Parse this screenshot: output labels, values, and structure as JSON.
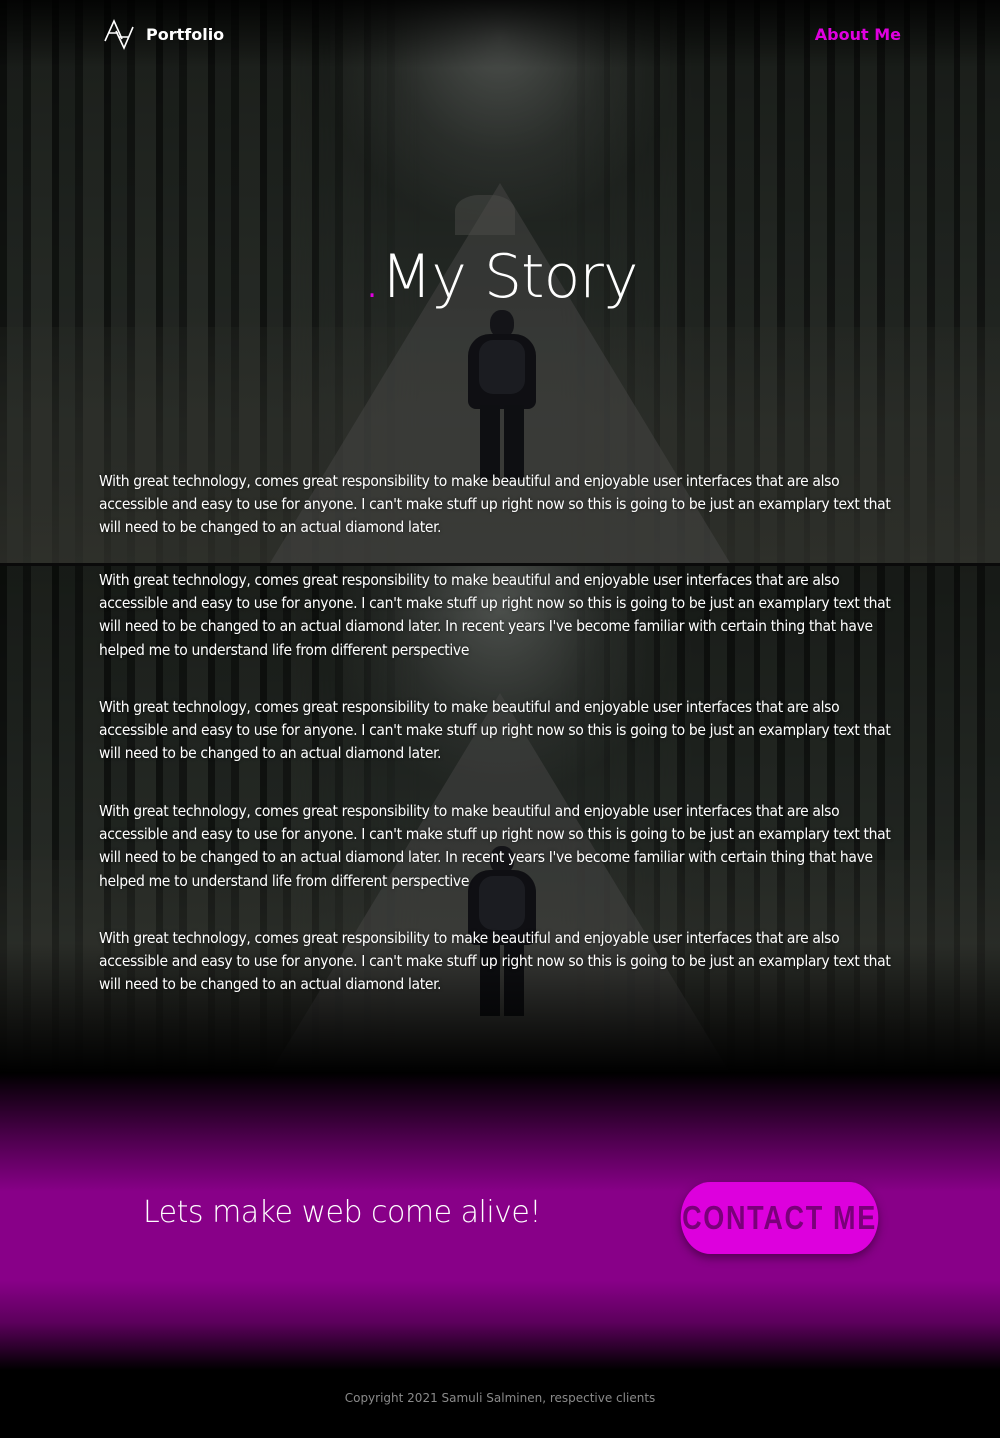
{
  "header": {
    "brand_label": "Portfolio",
    "nav_about": "About Me"
  },
  "hero": {
    "dot": ".",
    "title": "My Story"
  },
  "paragraphs": [
    "With great technology, comes great responsibility to make beautiful and enjoyable user interfaces that are also accessible and easy to use for anyone. I can't make stuff up right now so this is going to be just an examplary text that will need to be changed to an actual diamond later.",
    "With great technology, comes great responsibility to make beautiful and enjoyable user interfaces that are also accessible and easy to use for anyone. I can't make stuff up right now so this is going to be just an examplary text that will need to be changed to an actual diamond later. In recent years I've become familiar with certain thing that have helped me to understand life from different perspective",
    "With great technology, comes great responsibility to make beautiful and enjoyable user interfaces that are also accessible and easy to use for anyone. I can't make stuff up right now so this is going to be just an examplary text that will need to be changed to an actual diamond later.",
    "With great technology, comes great responsibility to make beautiful and enjoyable user interfaces that are also accessible and easy to use for anyone. I can't make stuff up right now so this is going to be just an examplary text that will need to be changed to an actual diamond later. In recent years I've become familiar with certain thing that have helped me to understand life from different perspective",
    "With great technology, comes great responsibility to make beautiful and enjoyable user interfaces that are also accessible and easy to use for anyone. I can't make stuff up right now so this is going to be just an examplary text that will need to be changed to an actual diamond later."
  ],
  "cta": {
    "text": "Lets make web come alive!",
    "button_label": "CONTACT ME"
  },
  "footer": {
    "copyright": "Copyright 2021 Samuli Salminen, respective clients"
  },
  "colors": {
    "accent": "#e000e0",
    "cta_band": "#880088",
    "button_fill": "#dd00dd",
    "button_text": "#7a007a"
  },
  "icons": {
    "logo": "sv-monogram-logo-icon"
  }
}
